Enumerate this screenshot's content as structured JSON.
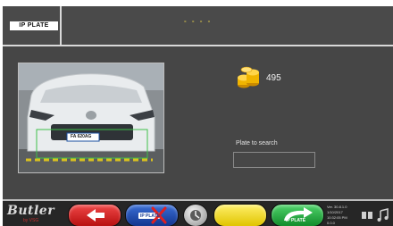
{
  "header": {
    "tab_label": "IP PLATE",
    "status_indicator": "- - - -"
  },
  "main": {
    "camera_feed": {
      "icon": "car-camera-image",
      "plate_text": "FA 620AG"
    },
    "credits": {
      "icon": "coins-icon",
      "count": "495"
    },
    "plate_search": {
      "label": "Plate to search",
      "value": ""
    }
  },
  "footer": {
    "brand": "Butler",
    "brand_sub": "by VSG",
    "buttons": [
      {
        "name": "back",
        "icon": "arrow-left-icon",
        "color": "#d42020"
      },
      {
        "name": "cancel",
        "icon": "cancel-cross-icon",
        "text": "IP PLATE",
        "color": "#2350b8"
      },
      {
        "name": "reset",
        "icon": "round-button-icon",
        "color": "#b0b0b0"
      },
      {
        "name": "empty",
        "icon": "blank",
        "color": "#f3dc1e"
      },
      {
        "name": "confirm",
        "icon": "arrow-right-curved-icon",
        "text": "IP PLATE",
        "color": "#2fb34a"
      }
    ],
    "info_lines": [
      "Ver. 30.8.1.0",
      "1/10/2017",
      "10:32:05 PM",
      "0.0.0"
    ],
    "tray_icons": [
      "network-icon",
      "music-icon"
    ]
  }
}
